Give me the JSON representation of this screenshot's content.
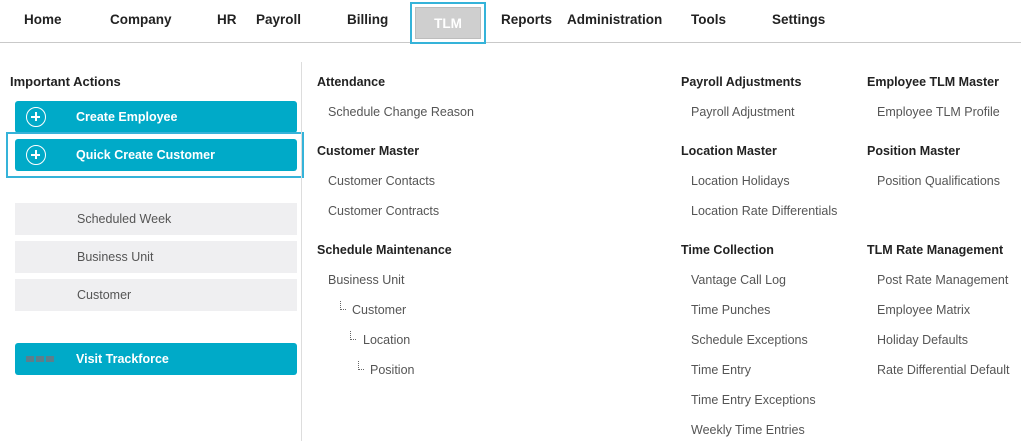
{
  "nav": {
    "items": [
      "Home",
      "Company",
      "HR",
      "Payroll",
      "Billing",
      "TLM",
      "Reports",
      "Administration",
      "Tools",
      "Settings"
    ],
    "active": "TLM"
  },
  "left": {
    "title": "Important Actions",
    "create_employee": "Create Employee",
    "quick_create_customer": "Quick Create Customer",
    "scheduled_week": "Scheduled Week",
    "business_unit": "Business Unit",
    "customer": "Customer",
    "visit_trackforce": "Visit Trackforce"
  },
  "col1": {
    "attendance": {
      "title": "Attendance",
      "links": [
        "Schedule Change Reason"
      ]
    },
    "customer_master": {
      "title": "Customer Master",
      "links": [
        "Customer Contacts",
        "Customer Contracts"
      ]
    },
    "schedule_maintenance": {
      "title": "Schedule Maintenance",
      "links": [
        "Business Unit",
        "Customer",
        "Location",
        "Position"
      ]
    }
  },
  "col2": {
    "payroll_adjustments": {
      "title": "Payroll Adjustments",
      "links": [
        "Payroll Adjustment"
      ]
    },
    "location_master": {
      "title": "Location Master",
      "links": [
        "Location Holidays",
        "Location Rate Differentials"
      ]
    },
    "time_collection": {
      "title": "Time Collection",
      "links": [
        "Vantage Call Log",
        "Time Punches",
        "Schedule Exceptions",
        "Time Entry",
        "Time Entry Exceptions",
        "Weekly Time Entries"
      ]
    }
  },
  "col3": {
    "employee_tlm_master": {
      "title": "Employee TLM Master",
      "links": [
        "Employee TLM Profile"
      ]
    },
    "position_master": {
      "title": "Position Master",
      "links": [
        "Position Qualifications"
      ]
    },
    "tlm_rate_management": {
      "title": "TLM Rate Management",
      "links": [
        "Post Rate Management",
        "Employee Matrix",
        "Holiday Defaults",
        "Rate Differential Default"
      ]
    }
  },
  "colors": {
    "accent": "#00aac8",
    "highlight": "#35b3d9"
  }
}
